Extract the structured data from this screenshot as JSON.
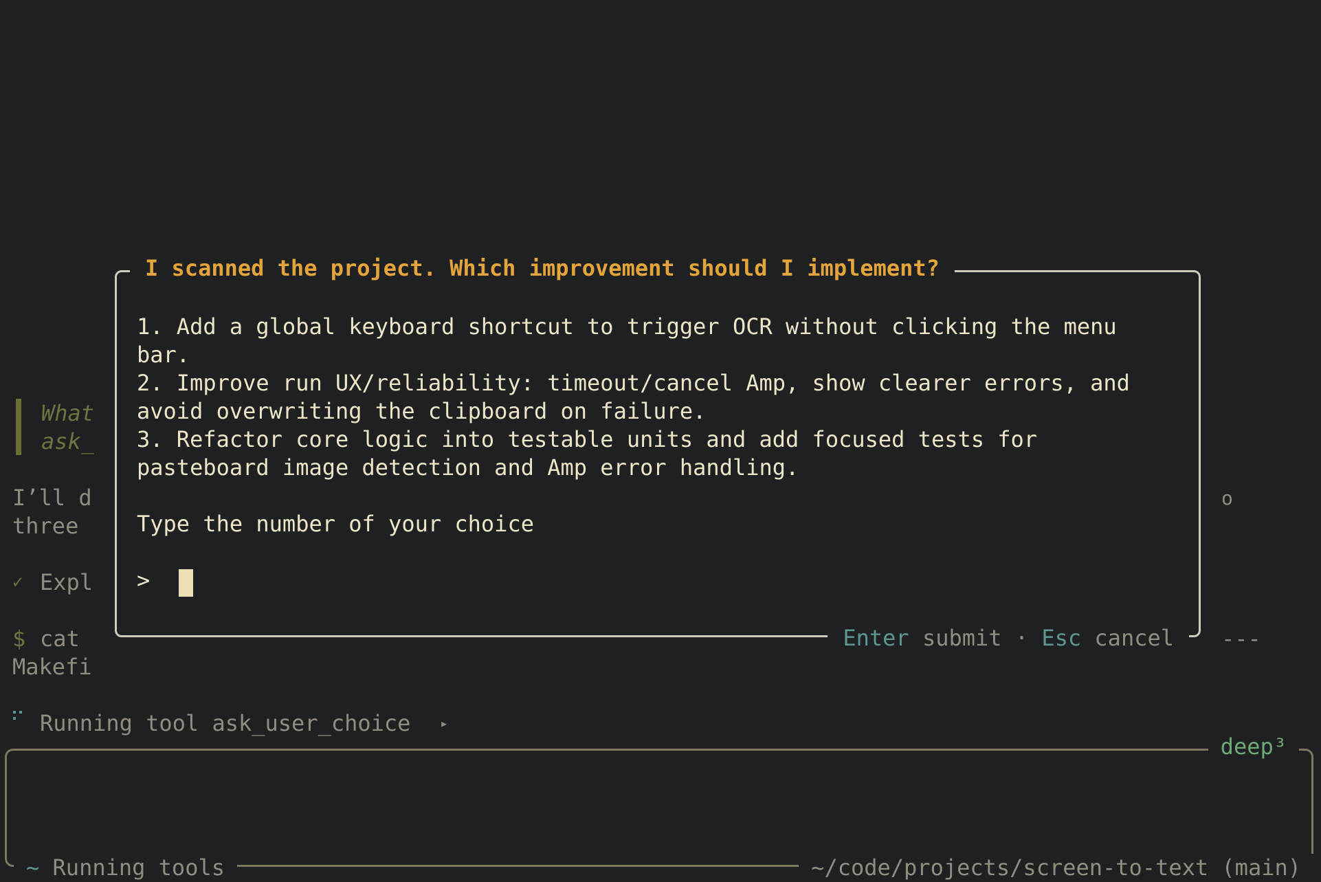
{
  "background": {
    "quote_line1": "What",
    "quote_line2": "ask_",
    "msg_line1": "I’ll d",
    "msg_line2": "three",
    "check_glyph": "✓",
    "check_text": "Expl",
    "prompt_glyph": "$",
    "cmd_text": "cat",
    "output_line": "Makefi",
    "right_fragment": "o",
    "right_dashes": "---"
  },
  "status": {
    "running_tool": "Running tool ask_user_choice",
    "expand_glyph": "▸"
  },
  "modal": {
    "title": "I scanned the project. Which improvement should I implement?",
    "options": [
      [
        "1. Add a global keyboard shortcut to trigger OCR without clicking the menu",
        "bar."
      ],
      [
        "2. Improve run UX/reliability: timeout/cancel Amp, show clearer errors, and",
        "avoid overwriting the clipboard on failure."
      ],
      [
        "3. Refactor core logic into testable units and add focused tests for",
        "pasteboard image detection and Amp error handling."
      ]
    ],
    "instruction": "Type the number of your choice",
    "prompt_symbol": ">",
    "input_value": "",
    "footer": {
      "enter_key": "Enter",
      "enter_action": "submit",
      "separator": "·",
      "esc_key": "Esc",
      "esc_action": "cancel"
    }
  },
  "input_box": {
    "mode_label": "deep³",
    "spinner_glyph": "~",
    "status_text": "Running tools",
    "path": "~/code/projects/screen-to-text (main)"
  },
  "colors": {
    "background": "#1f2022",
    "accent": "#e2a43b",
    "teal": "#5c9592",
    "green": "#6fa877",
    "border": "#cfcbbd"
  }
}
